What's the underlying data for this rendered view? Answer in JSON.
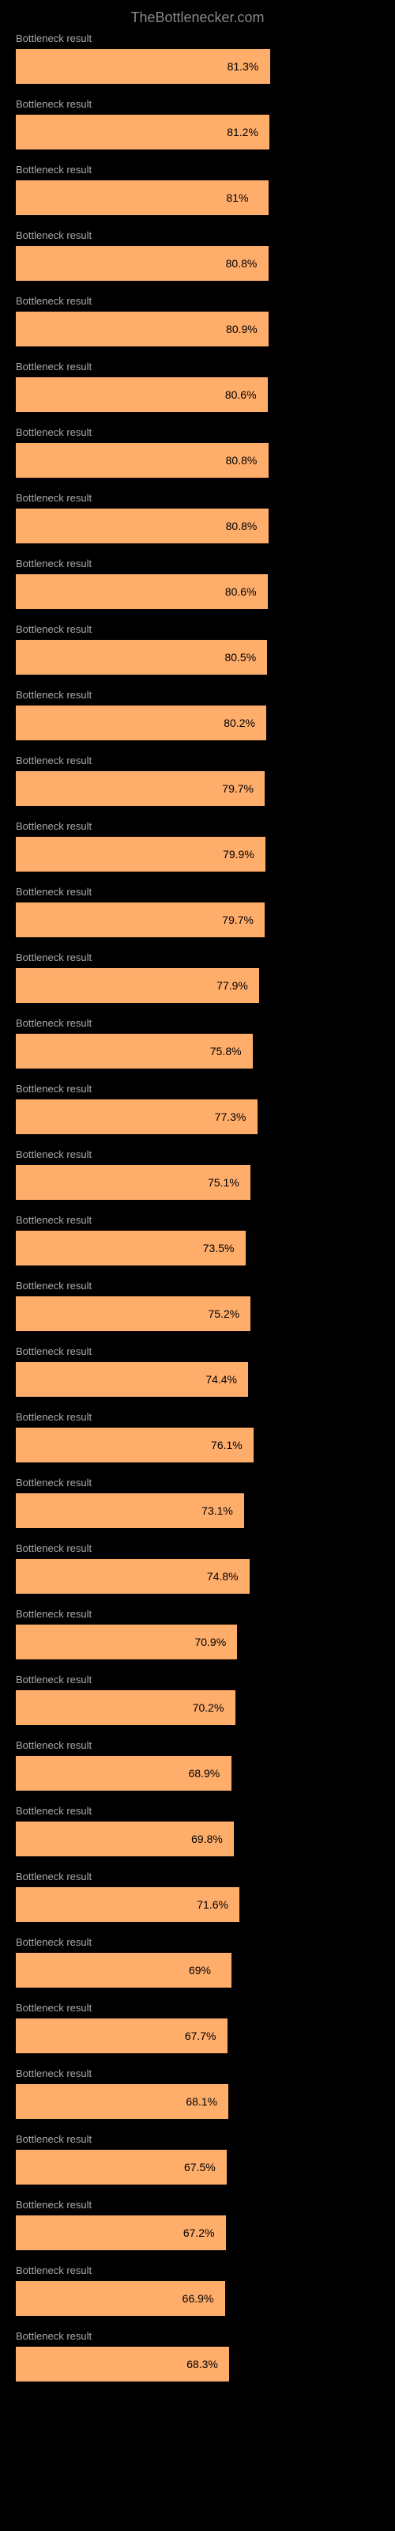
{
  "header": {
    "title": "TheBottlenecker.com"
  },
  "chart_data": {
    "type": "bar",
    "title": "TheBottlenecker.com",
    "xlabel": "",
    "ylabel": "",
    "ylim": [
      0,
      100
    ],
    "categories": [
      "Bottleneck result",
      "Bottleneck result",
      "Bottleneck result",
      "Bottleneck result",
      "Bottleneck result",
      "Bottleneck result",
      "Bottleneck result",
      "Bottleneck result",
      "Bottleneck result",
      "Bottleneck result",
      "Bottleneck result",
      "Bottleneck result",
      "Bottleneck result",
      "Bottleneck result",
      "Bottleneck result",
      "Bottleneck result",
      "Bottleneck result",
      "Bottleneck result",
      "Bottleneck result",
      "Bottleneck result",
      "Bottleneck result",
      "Bottleneck result",
      "Bottleneck result",
      "Bottleneck result",
      "Bottleneck result",
      "Bottleneck result",
      "Bottleneck result",
      "Bottleneck result",
      "Bottleneck result",
      "Bottleneck result",
      "Bottleneck result",
      "Bottleneck result",
      "Bottleneck result",
      "Bottleneck result",
      "Bottleneck result",
      "Bottleneck result"
    ],
    "values": [
      81.3,
      81.2,
      81.0,
      80.8,
      80.9,
      80.6,
      80.8,
      80.8,
      80.6,
      80.5,
      80.2,
      79.7,
      79.9,
      79.7,
      77.9,
      75.8,
      77.3,
      75.1,
      73.5,
      75.2,
      74.4,
      76.1,
      73.1,
      74.8,
      70.9,
      70.2,
      68.9,
      69.8,
      71.6,
      69.0,
      67.7,
      68.1,
      67.5,
      67.2,
      66.9,
      68.3
    ],
    "value_labels": [
      "81.3%",
      "81.2%",
      "81%",
      "80.8%",
      "80.9%",
      "80.6%",
      "80.8%",
      "80.8%",
      "80.6%",
      "80.5%",
      "80.2%",
      "79.7%",
      "79.9%",
      "79.7%",
      "77.9%",
      "75.8%",
      "77.3%",
      "75.1%",
      "73.5%",
      "75.2%",
      "74.4%",
      "76.1%",
      "73.1%",
      "74.8%",
      "70.9%",
      "70.2%",
      "68.9%",
      "69.8%",
      "71.6%",
      "69%",
      "67.7%",
      "68.1%",
      "67.5%",
      "67.2%",
      "66.9%",
      "68.3%"
    ]
  }
}
